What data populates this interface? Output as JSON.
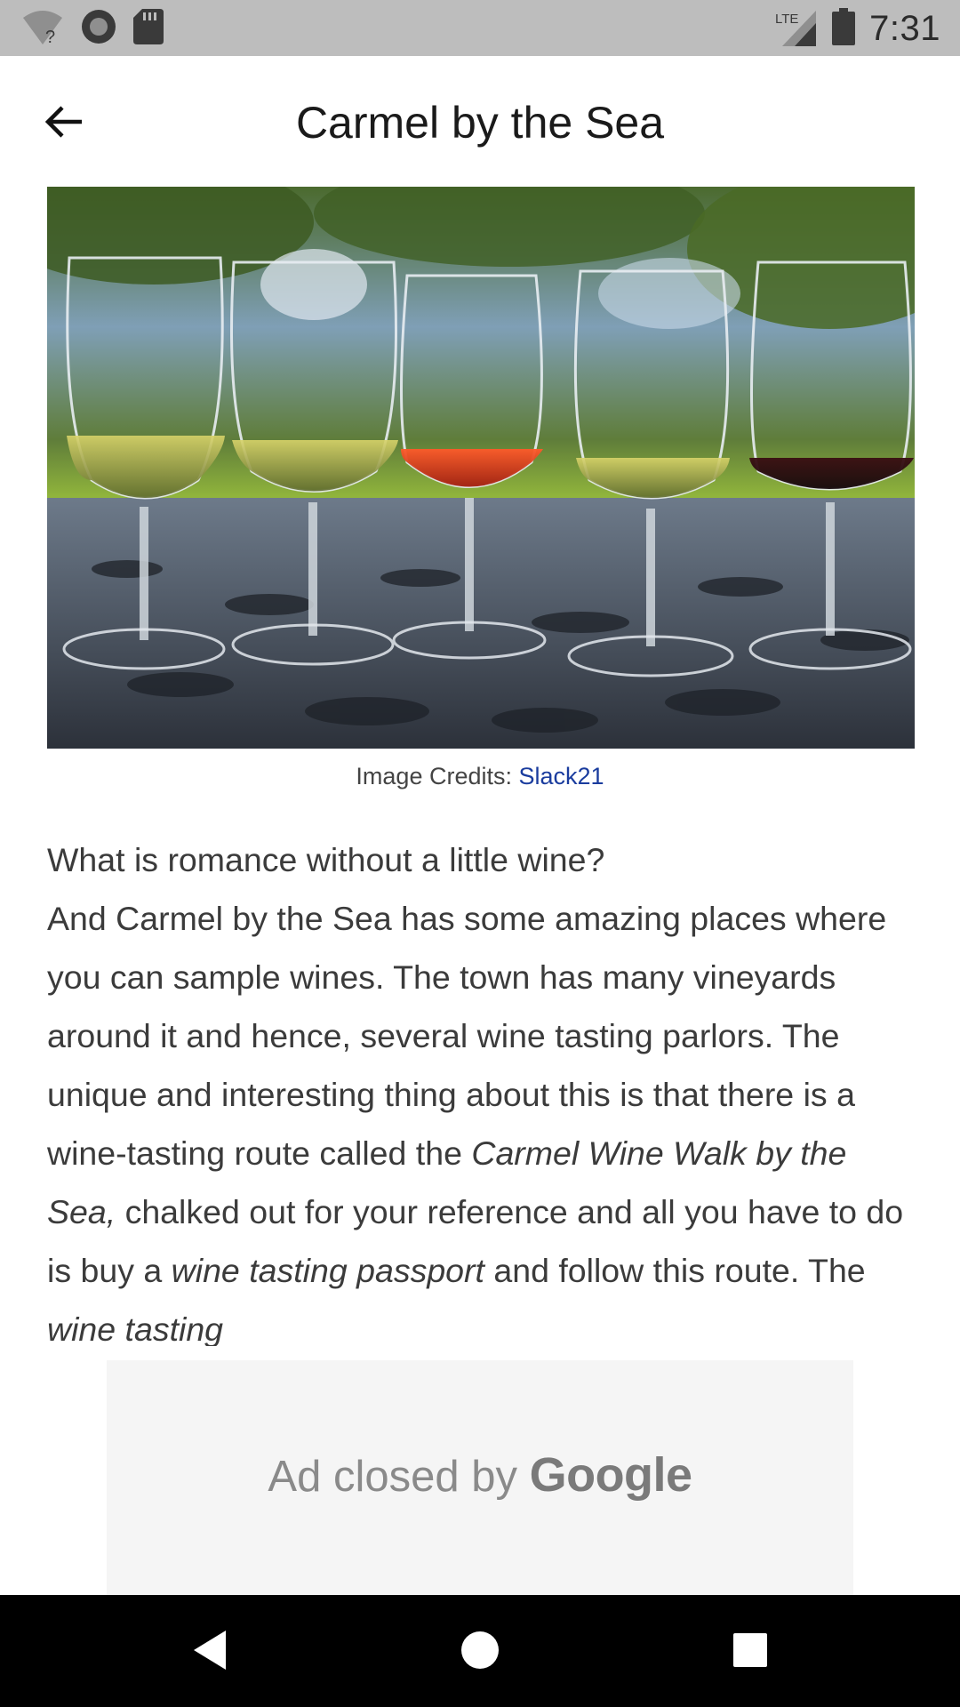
{
  "status_bar": {
    "network_label": "LTE",
    "time": "7:31"
  },
  "header": {
    "title": "Carmel by the Sea",
    "back_icon": "arrow-left-icon"
  },
  "hero_image": {
    "description_icon": "wine-glasses-photo"
  },
  "caption": {
    "prefix": "Image Credits: ",
    "link": "Slack21"
  },
  "article": {
    "line1": "What is romance without a little wine?",
    "p2_a": "And Carmel by the Sea has some amazing places where you can sample wines. The town has many vineyards around it and hence, several wine tasting parlors. The unique and interesting thing about this is that there is a wine-tasting route called the ",
    "p2_em1": "Carmel Wine Walk by the Sea,",
    "p2_b": " chalked out for your reference and all you have to do is buy a ",
    "p2_em2": "wine tasting passport",
    "p2_c": " and follow this route. The ",
    "p2_em3": "wine tasting"
  },
  "ad": {
    "text": "Ad closed by ",
    "brand": "Google"
  },
  "nav_bar": {
    "back_icon": "triangle-back-icon",
    "home_icon": "circle-home-icon",
    "recents_icon": "square-recents-icon"
  },
  "colors": {
    "status_bar_bg": "#bdbdbd",
    "link": "#1a3c9e",
    "nav_bg": "#000000",
    "ad_bg": "#f5f5f5"
  }
}
